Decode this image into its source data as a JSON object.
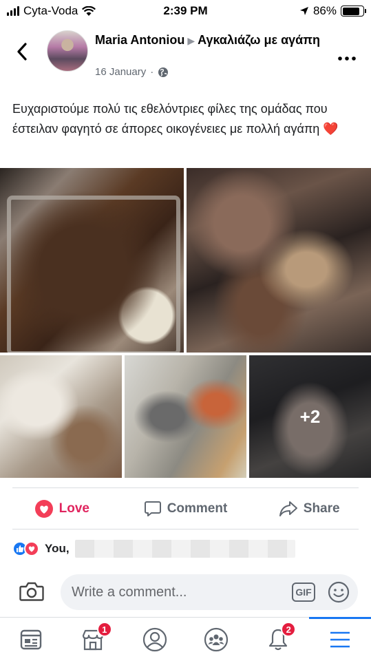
{
  "status_bar": {
    "carrier": "Cyta-Voda",
    "time": "2:39 PM",
    "battery_percent": "86%",
    "battery_level": 0.86
  },
  "post": {
    "author": "Maria Antoniou",
    "group": "Αγκαλιάζω με αγάπη",
    "date": "16 January",
    "separator": "·",
    "privacy_icon": "globe-icon",
    "text": "Ευχαριστούμε πολύ τις εθελόντριες φίλες της ομάδας που έστειλαν φαγητό σε άπορες οικογένειες με πολλή αγάπη",
    "text_emoji": "❤️",
    "more_photos_label": "+2"
  },
  "actions": {
    "love_label": "Love",
    "comment_label": "Comment",
    "share_label": "Share"
  },
  "reactions": {
    "summary_prefix": "You,"
  },
  "comment_box": {
    "placeholder": "Write a comment...",
    "gif_label": "GIF"
  },
  "bottom_nav": {
    "items": [
      {
        "name": "news-feed",
        "badge": ""
      },
      {
        "name": "marketplace",
        "badge": "1"
      },
      {
        "name": "profile",
        "badge": ""
      },
      {
        "name": "groups",
        "badge": ""
      },
      {
        "name": "notifications",
        "badge": "2"
      },
      {
        "name": "menu",
        "badge": ""
      }
    ]
  },
  "colors": {
    "accent": "#1877f2",
    "love": "#e0245e",
    "badge": "#e41e3f",
    "muted": "#606770"
  }
}
